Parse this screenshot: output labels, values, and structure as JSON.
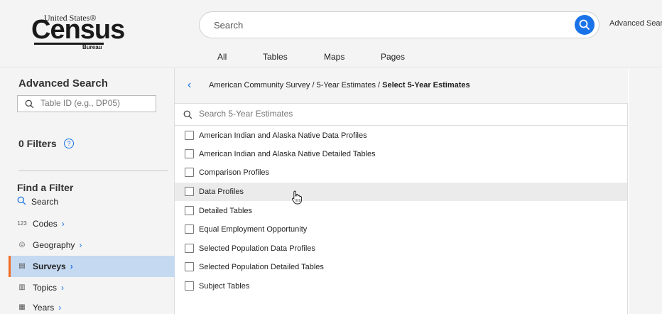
{
  "header": {
    "logo": {
      "united_states": "United States®",
      "census": "Census",
      "bureau": "Bureau"
    },
    "search_placeholder": "Search",
    "advanced_link": "Advanced Searc",
    "tabs": [
      "All",
      "Tables",
      "Maps",
      "Pages"
    ]
  },
  "sidebar": {
    "title": "Advanced Search",
    "table_id_placeholder": "Table ID (e.g., DP05)",
    "filters_label": "0 Filters",
    "help_glyph": "?",
    "find_title": "Find a Filter",
    "search_label": "Search",
    "nav": [
      {
        "label": "Codes",
        "icon": "123-icon",
        "glyph": "123"
      },
      {
        "label": "Geography",
        "icon": "map-pin-icon",
        "glyph": "◎"
      },
      {
        "label": "Surveys",
        "icon": "survey-icon",
        "glyph": "▤",
        "active": true
      },
      {
        "label": "Topics",
        "icon": "book-icon",
        "glyph": "▥"
      },
      {
        "label": "Years",
        "icon": "calendar-icon",
        "glyph": "▦"
      }
    ],
    "chevron": "›"
  },
  "center": {
    "back_glyph": "‹",
    "breadcrumb_path": "American Community Survey / 5-Year Estimates / ",
    "breadcrumb_current": "Select 5-Year Estimates",
    "search_placeholder": "Search 5-Year Estimates",
    "options": [
      "American Indian and Alaska Native Data Profiles",
      "American Indian and Alaska Native Detailed Tables",
      "Comparison Profiles",
      "Data Profiles",
      "Detailed Tables",
      "Equal Employment Opportunity",
      "Selected Population Data Profiles",
      "Selected Population Detailed Tables",
      "Subject Tables"
    ],
    "hovered_index": 3
  },
  "colors": {
    "accent": "#1a73e8",
    "active_bg": "#c5d9f1",
    "active_border": "#f26b22"
  }
}
